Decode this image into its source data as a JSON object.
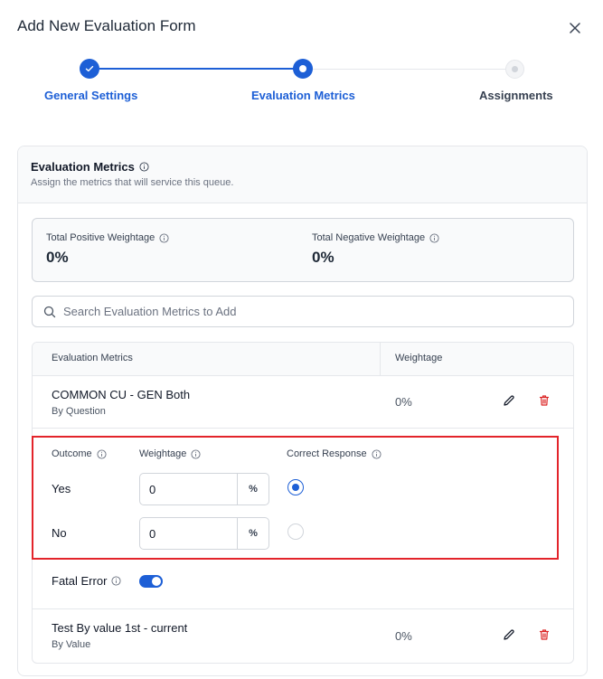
{
  "modal": {
    "title": "Add New Evaluation Form"
  },
  "stepper": {
    "steps": [
      {
        "label": "General Settings",
        "state": "complete"
      },
      {
        "label": "Evaluation Metrics",
        "state": "active"
      },
      {
        "label": "Assignments",
        "state": "pending"
      }
    ]
  },
  "section": {
    "title": "Evaluation Metrics",
    "subtitle": "Assign the metrics that will service this queue."
  },
  "totals": {
    "positive_label": "Total Positive Weightage",
    "positive_value": "0%",
    "negative_label": "Total Negative Weightage",
    "negative_value": "0%"
  },
  "search": {
    "placeholder": "Search Evaluation Metrics to Add",
    "value": ""
  },
  "table": {
    "col_metrics": "Evaluation Metrics",
    "col_weightage": "Weightage",
    "rows": [
      {
        "name": "COMMON CU - GEN Both",
        "type": "By Question",
        "weight": "0%"
      },
      {
        "name": "Test By value 1st - current",
        "type": "By Value",
        "weight": "0%"
      }
    ]
  },
  "outcomes": {
    "col_outcome": "Outcome",
    "col_weightage": "Weightage",
    "col_correct": "Correct Response",
    "unit": "%",
    "items": [
      {
        "label": "Yes",
        "value": "0",
        "correct": true
      },
      {
        "label": "No",
        "value": "0",
        "correct": false
      }
    ]
  },
  "fatal_error": {
    "label": "Fatal Error",
    "enabled": true
  },
  "colors": {
    "accent": "#1d5fd6",
    "delete": "#dc2626",
    "highlight": "#e3242b"
  }
}
